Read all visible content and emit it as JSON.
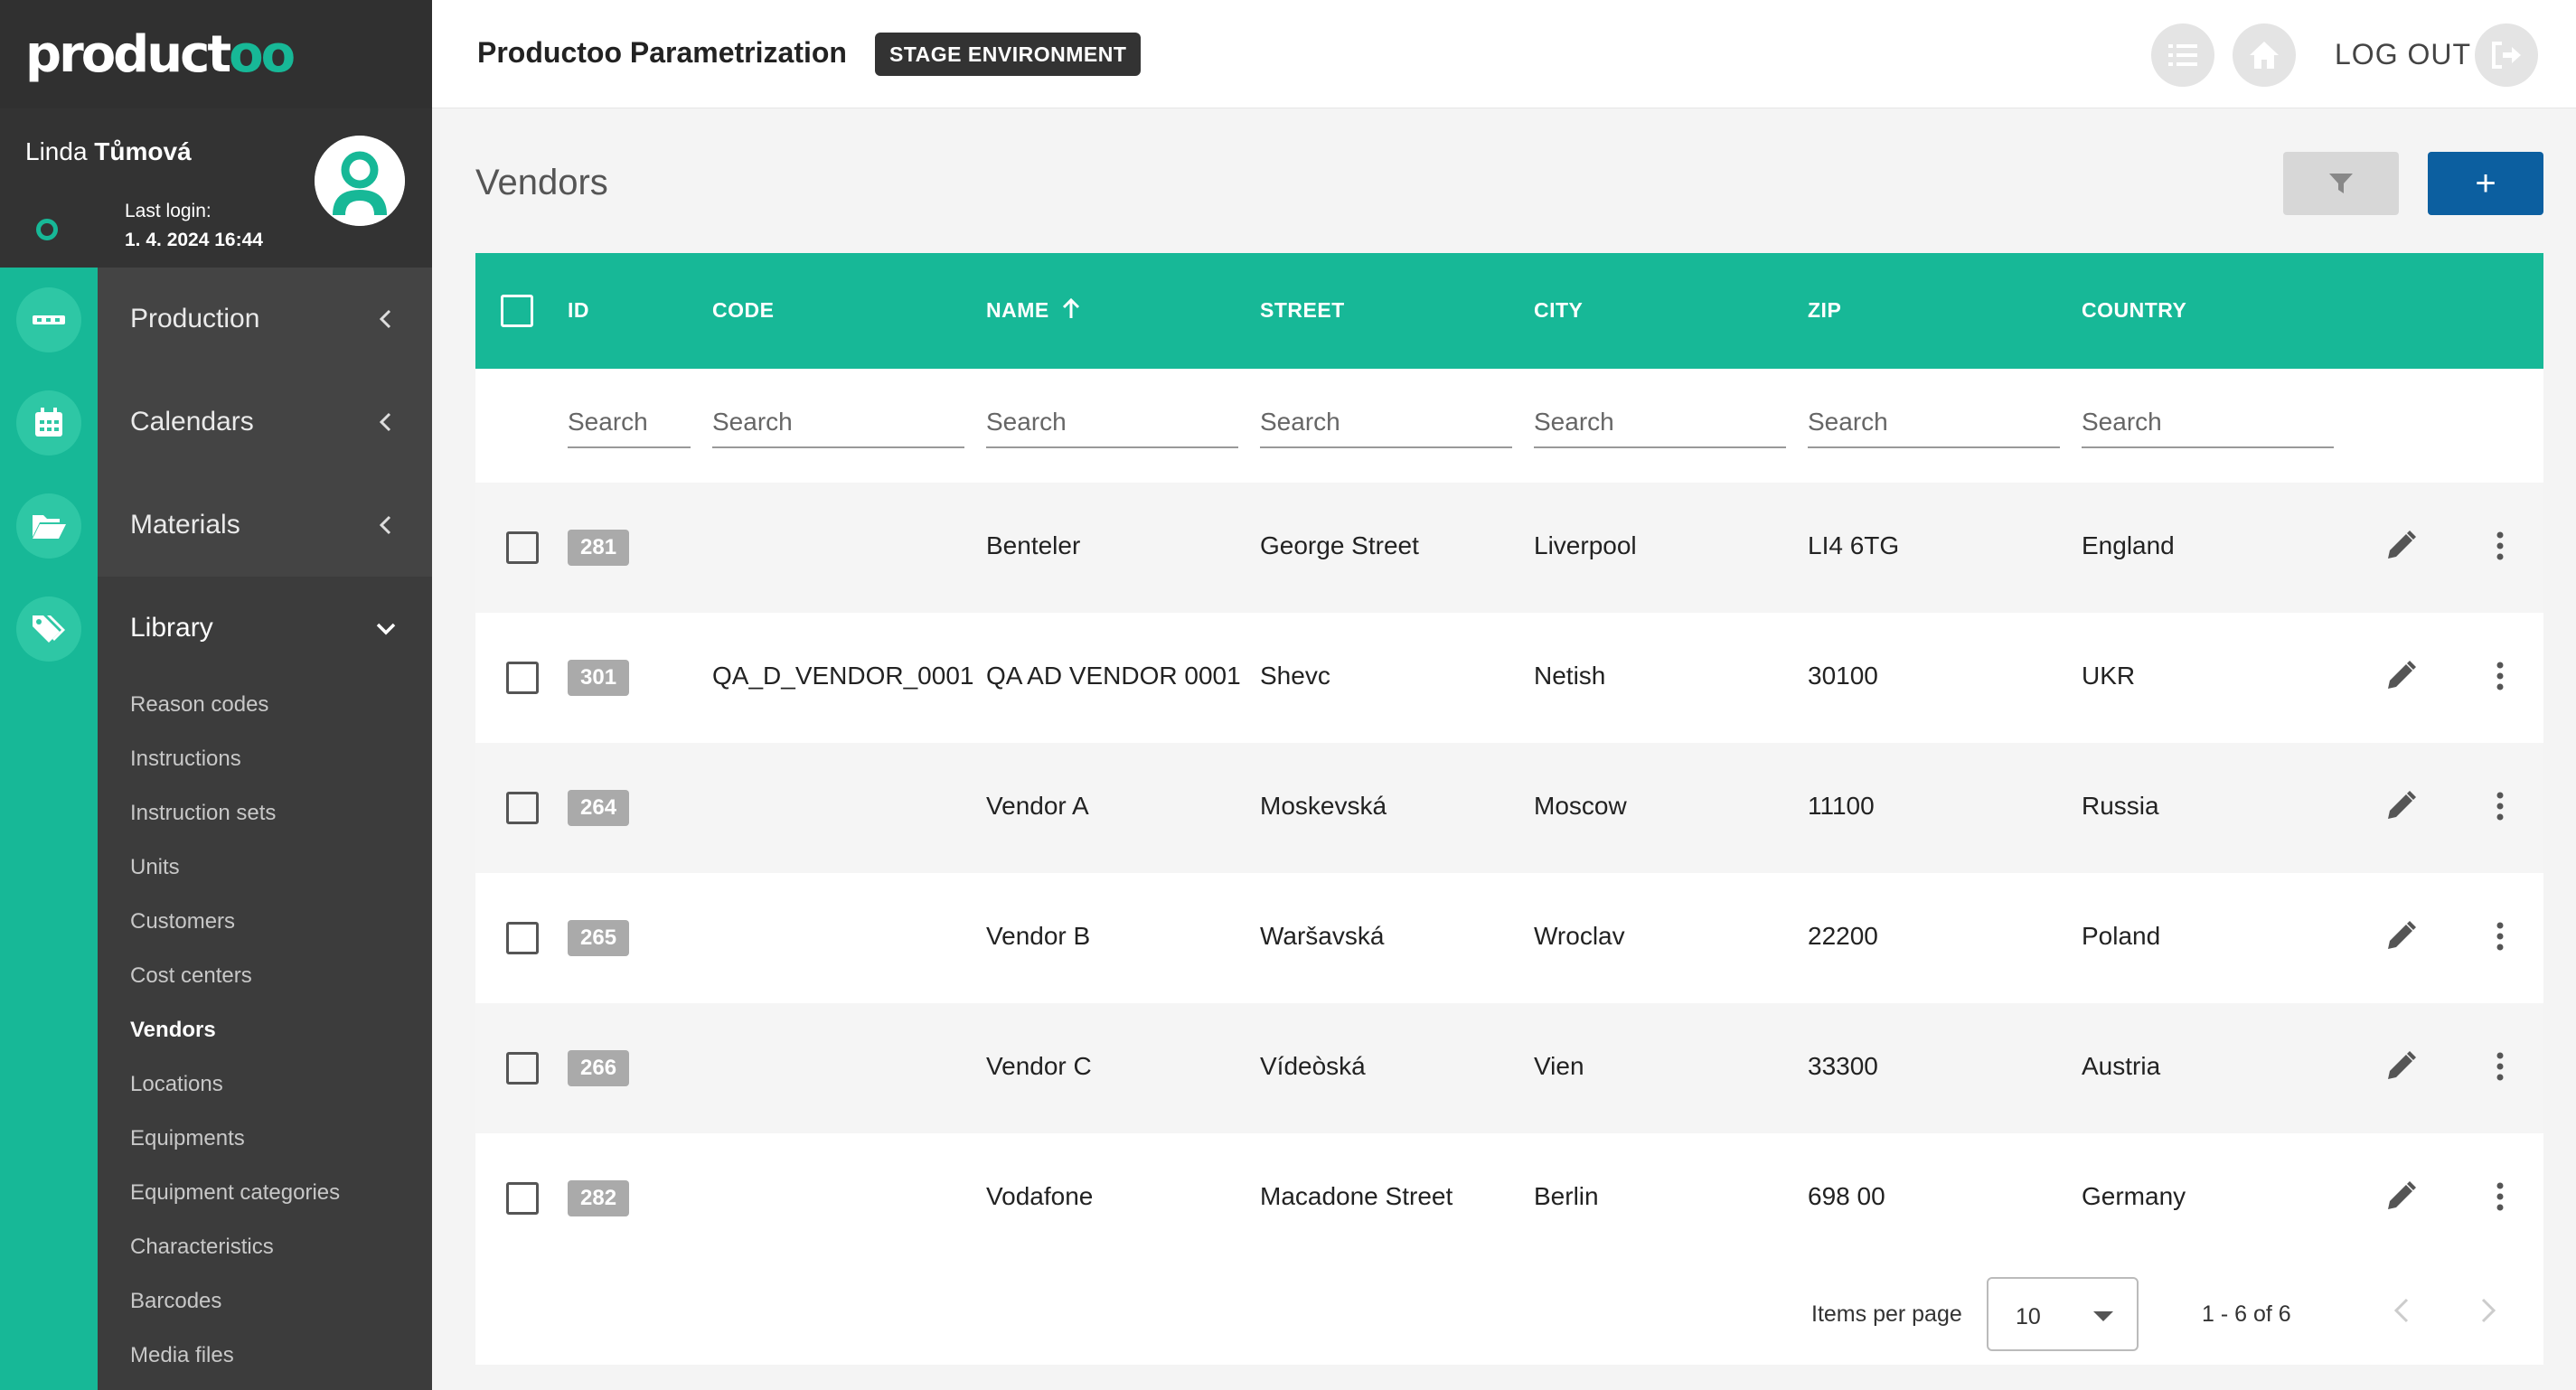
{
  "app": {
    "logo_text": "productoo",
    "title": "Productoo Parametrization",
    "environment": "STAGE ENVIRONMENT",
    "logout_label": "LOG OUT",
    "accent_color": "#17b897",
    "primary_button_color": "#0c5fa0"
  },
  "user": {
    "first_name": "Linda",
    "last_name": "Tůmová",
    "last_login_label": "Last login:",
    "last_login_value": "1. 4. 2024 16:44"
  },
  "nav": {
    "production": "Production",
    "calendars": "Calendars",
    "materials": "Materials",
    "library": "Library",
    "library_items": [
      "Reason codes",
      "Instructions",
      "Instruction sets",
      "Units",
      "Customers",
      "Cost centers",
      "Vendors",
      "Locations",
      "Equipments",
      "Equipment categories",
      "Characteristics",
      "Barcodes",
      "Media files"
    ],
    "active_item": "Vendors"
  },
  "page": {
    "title": "Vendors",
    "add_label": "+"
  },
  "table": {
    "columns": [
      "ID",
      "CODE",
      "NAME",
      "STREET",
      "CITY",
      "ZIP",
      "COUNTRY"
    ],
    "sort_column": "NAME",
    "sort_direction": "ascending",
    "search_placeholder": "Search",
    "rows": [
      {
        "id": "281",
        "code": "",
        "name": "Benteler",
        "street": "George Street",
        "city": "Liverpool",
        "zip": "LI4 6TG",
        "country": "England"
      },
      {
        "id": "301",
        "code": "QA_D_VENDOR_0001",
        "name": "QA AD VENDOR 0001",
        "street": "Shevc",
        "city": "Netish",
        "zip": "30100",
        "country": "UKR"
      },
      {
        "id": "264",
        "code": "",
        "name": "Vendor A",
        "street": "Moskevská",
        "city": "Moscow",
        "zip": "11100",
        "country": "Russia"
      },
      {
        "id": "265",
        "code": "",
        "name": "Vendor B",
        "street": "Waršavská",
        "city": "Wroclav",
        "zip": "22200",
        "country": "Poland"
      },
      {
        "id": "266",
        "code": "",
        "name": "Vendor C",
        "street": "Vídeòská",
        "city": "Vien",
        "zip": "33300",
        "country": "Austria"
      },
      {
        "id": "282",
        "code": "",
        "name": "Vodafone",
        "street": "Macadone Street",
        "city": "Berlin",
        "zip": "698 00",
        "country": "Germany"
      }
    ]
  },
  "paginator": {
    "items_per_page_label": "Items per page",
    "page_size": "10",
    "range_label": "1 - 6 of 6"
  }
}
